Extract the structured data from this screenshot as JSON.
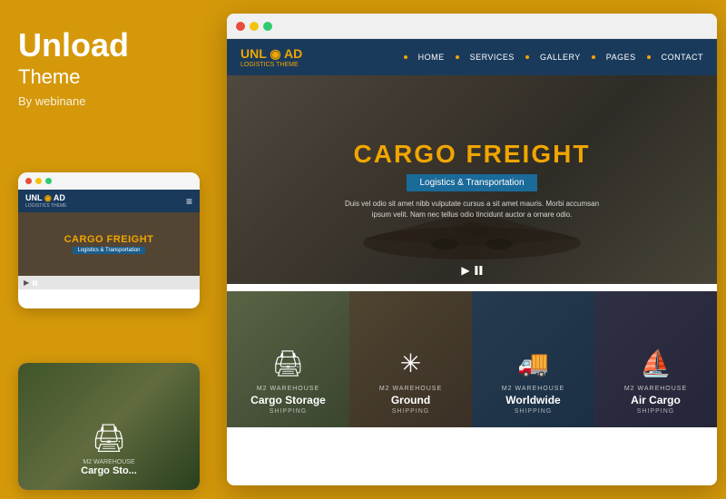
{
  "theme": {
    "name": "Unload",
    "subtitle": "Theme",
    "author": "By webinane",
    "accent_color": "#D4980A"
  },
  "browser": {
    "dots": [
      "red",
      "yellow",
      "green"
    ]
  },
  "mobile_preview": {
    "logo": "UNL AD",
    "logo_tagline": "LOGISTICS THEME"
  },
  "site": {
    "logo": "UNL AD",
    "logo_tagline": "LOGISTICS THEME",
    "nav_items": [
      {
        "label": "HOME"
      },
      {
        "label": "SERVICES"
      },
      {
        "label": "GALLERY"
      },
      {
        "label": "PAGES"
      },
      {
        "label": "CONTACT"
      }
    ],
    "hero": {
      "title": "CARGO FREIGHT",
      "badge": "Logistics & Transportation",
      "body": "Duis vel odio sit amet nibb vulputate cursus a sit amet mauris. Morbi accumsan ipsum velit. Nam nec tellus odio tincidunt auctor a ornare odio."
    },
    "services": [
      {
        "label": "M2 Warehouse",
        "title": "Cargo Storage",
        "sub": "SHIPPING",
        "icon": "🖨"
      },
      {
        "label": "M2 Warehouse",
        "title": "Ground",
        "sub": "SHIPPING",
        "icon": "✳"
      },
      {
        "label": "M2 Warehouse",
        "title": "Worldwide",
        "sub": "SHIPPING",
        "icon": "🚚"
      },
      {
        "label": "M2 Warehouse",
        "title": "Air Cargo",
        "sub": "SHIPPING",
        "icon": "⛵"
      }
    ]
  }
}
